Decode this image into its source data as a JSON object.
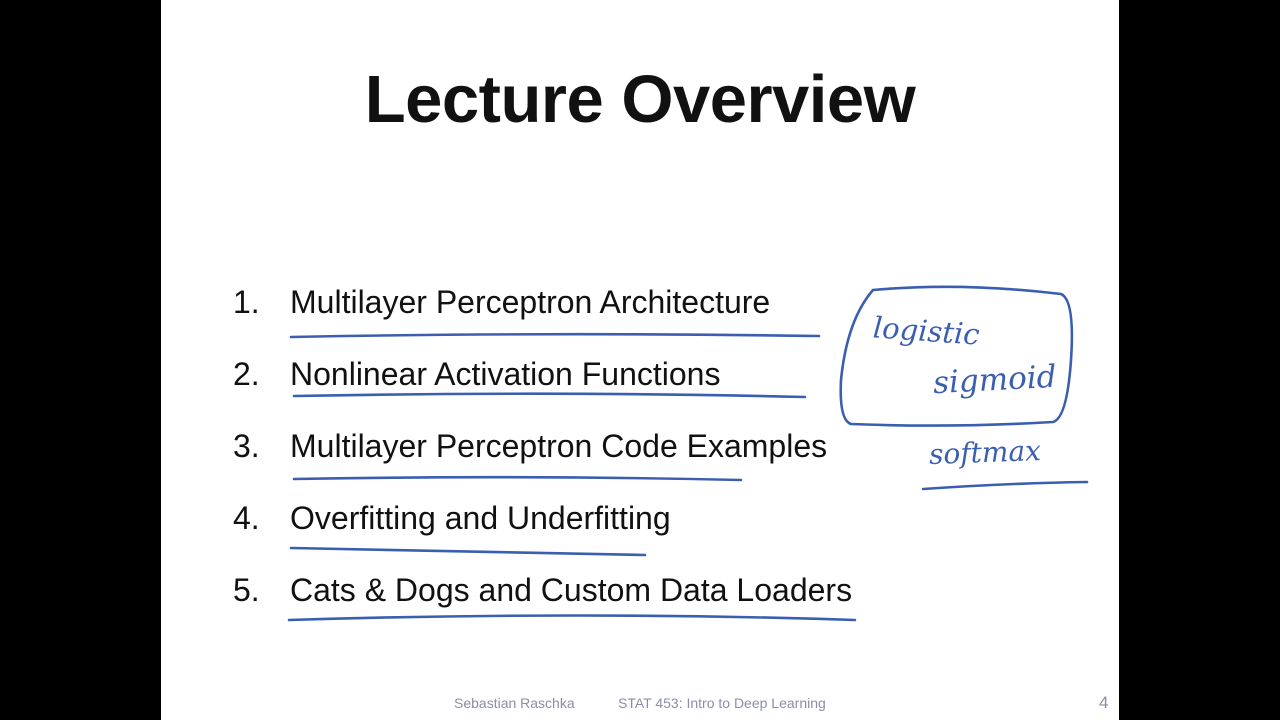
{
  "slide": {
    "title": "Lecture Overview",
    "items": [
      {
        "number": "1.",
        "text": "Multilayer Perceptron Architecture"
      },
      {
        "number": "2.",
        "text": "Nonlinear Activation Functions"
      },
      {
        "number": "3.",
        "text": "Multilayer Perceptron Code Examples"
      },
      {
        "number": "4.",
        "text": "Overfitting and Underfitting"
      },
      {
        "number": "5.",
        "text": "Cats & Dogs and Custom Data Loaders"
      }
    ],
    "annotations": {
      "note_1": "logistic",
      "note_2": "sigmoid",
      "note_3": "softmax",
      "ink_color": "#3a5fb0"
    },
    "footer": {
      "author": "Sebastian Raschka",
      "course": "STAT 453: Intro to Deep Learning",
      "page": "4"
    }
  }
}
